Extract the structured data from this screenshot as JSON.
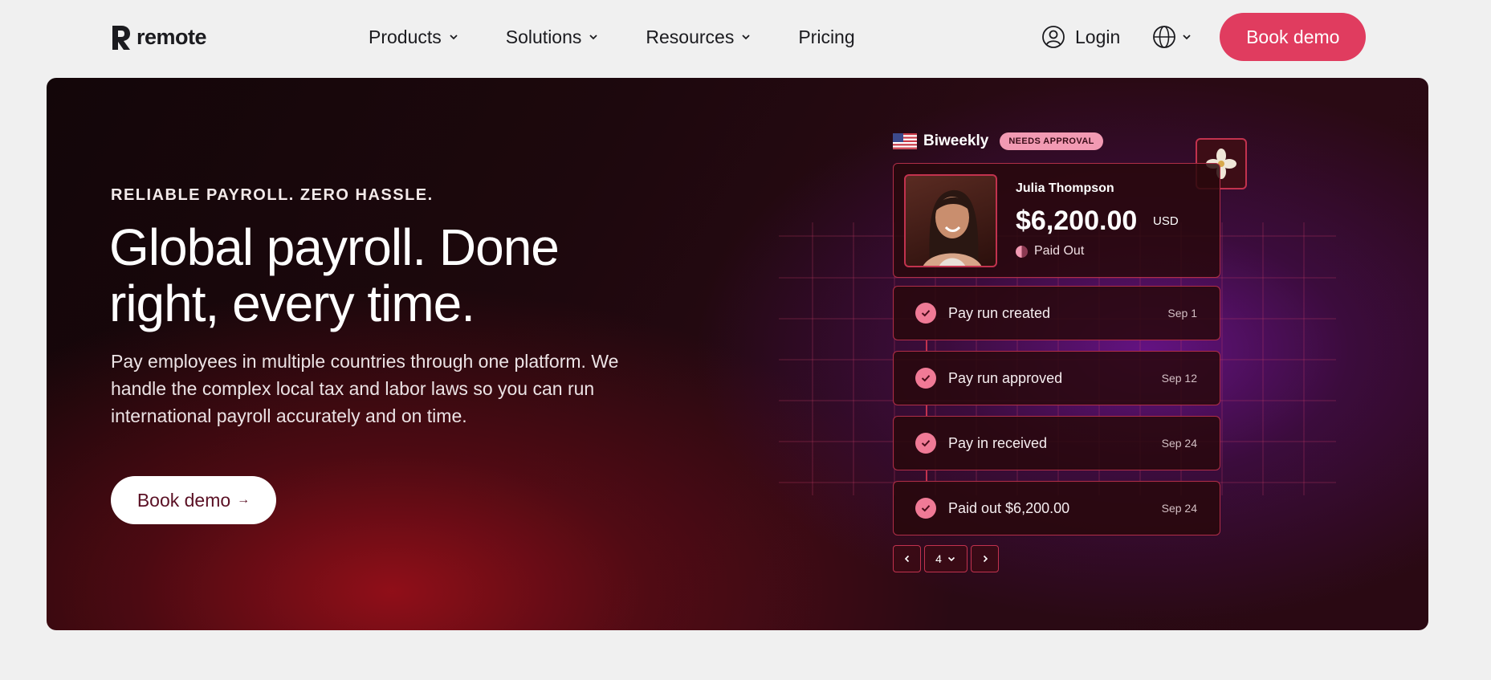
{
  "nav": {
    "logo_text": "remote",
    "links": [
      {
        "label": "Products",
        "has_dropdown": true
      },
      {
        "label": "Solutions",
        "has_dropdown": true
      },
      {
        "label": "Resources",
        "has_dropdown": true
      },
      {
        "label": "Pricing",
        "has_dropdown": false
      }
    ],
    "login_label": "Login",
    "language_icon": "globe-icon",
    "cta_label": "Book demo",
    "cta_color": "#e03c5f"
  },
  "hero": {
    "eyebrow": "RELIABLE PAYROLL. ZERO HASSLE.",
    "headline": "Global payroll. Done right, every time.",
    "subtext": "Pay employees in multiple countries through one platform. We handle the complex local tax and labor laws so you can run international payroll accurately and on time.",
    "cta_label": "Book demo",
    "cta_arrow": "→"
  },
  "payroll_card": {
    "frequency": "Biweekly",
    "badge": "NEEDS APPROVAL",
    "employee_name": "Julia Thompson",
    "amount": "$6,200.00",
    "currency": "USD",
    "status": "Paid Out",
    "steps": [
      {
        "label": "Pay run created",
        "date": "Sep 1"
      },
      {
        "label": "Pay run approved",
        "date": "Sep 12"
      },
      {
        "label": "Pay in received",
        "date": "Sep 24"
      },
      {
        "label": "Paid out $6,200.00",
        "date": "Sep 24"
      }
    ],
    "pager_value": "4"
  }
}
